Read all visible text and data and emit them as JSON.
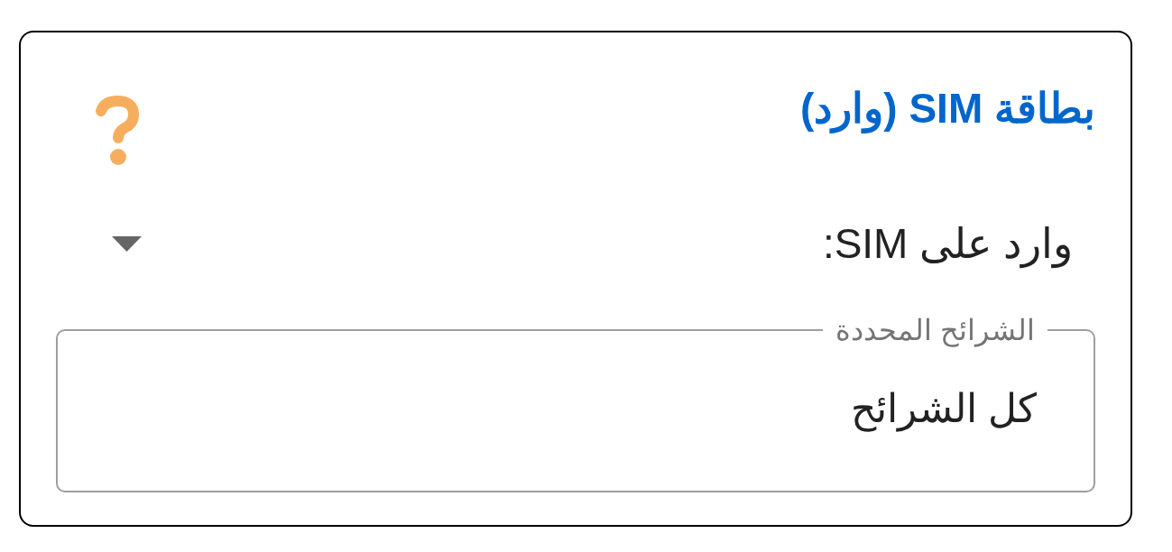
{
  "card": {
    "title": "بطاقة SIM (وارد)"
  },
  "sim_dropdown": {
    "label": "وارد على SIM:"
  },
  "selected_sims": {
    "label": "الشرائح المحددة",
    "value": "كل الشرائح"
  }
}
